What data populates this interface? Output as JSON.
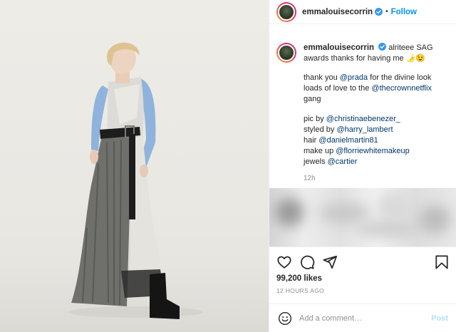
{
  "header": {
    "username": "emmalouisecorrin",
    "separator": "•",
    "follow_label": "Follow"
  },
  "caption": {
    "username": "emmalouisecorrin",
    "first_line": "alriteee SAG awards thanks for having me 🌛😉",
    "lines": [
      [
        "thank you ",
        "@prada",
        " for the divine look"
      ],
      [
        "loads of love to the ",
        "@thecrownnetflix"
      ],
      [
        "gang"
      ],
      [],
      [
        "pic by ",
        "@christinaebenezer_"
      ],
      [
        "styled by ",
        "@harry_lambert"
      ],
      [
        "hair ",
        "@danielmartin81"
      ],
      [
        "make up ",
        "@florriewhitemakeup"
      ],
      [
        "jewels ",
        "@cartier"
      ]
    ],
    "time": "12h"
  },
  "stats": {
    "likes": "99,200 likes",
    "posted": "12 HOURS AGO"
  },
  "comment": {
    "placeholder": "Add a comment…",
    "post_label": "Post"
  },
  "colors": {
    "accent": "#0095f6",
    "mention": "#00376b",
    "muted": "#8e8e8e",
    "post_disabled": "#b2dffc"
  },
  "icons": {
    "verified": "verified-badge-icon",
    "like": "heart-icon",
    "comment": "speech-bubble-icon",
    "share": "paper-plane-icon",
    "save": "bookmark-icon",
    "emoji": "smiley-icon"
  }
}
